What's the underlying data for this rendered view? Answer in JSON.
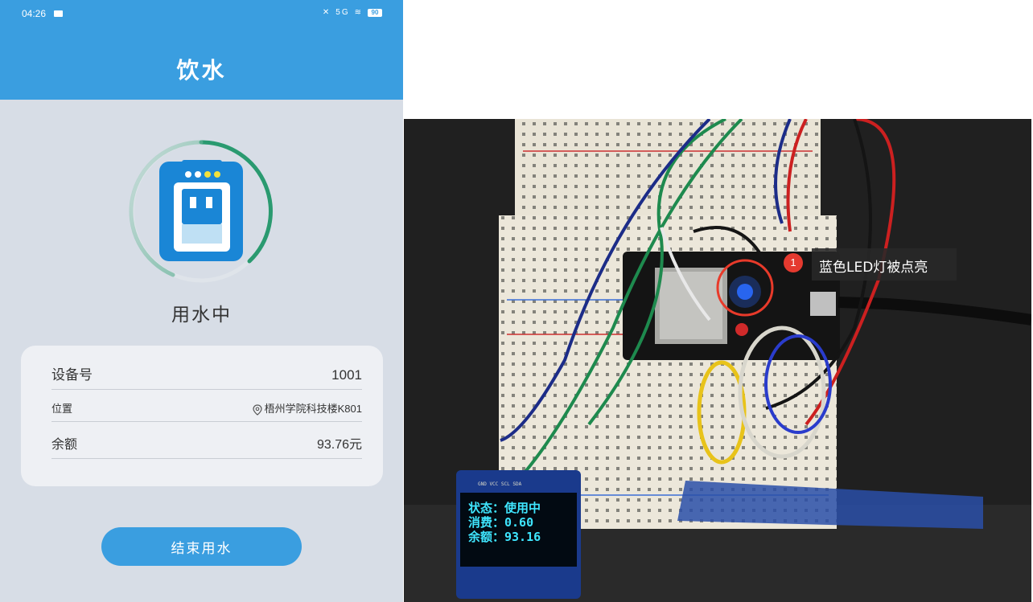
{
  "status_bar": {
    "time": "04:26",
    "network": "5G",
    "battery": "90"
  },
  "header": {
    "title": "饮水"
  },
  "usage": {
    "status_text": "用水中",
    "icon": "water-dispenser-icon"
  },
  "info": {
    "device_label": "设备号",
    "device_value": "1001",
    "location_label": "位置",
    "location_value": "梧州学院科技楼K801",
    "balance_label": "余额",
    "balance_value": "93.76元"
  },
  "actions": {
    "end_label": "结束用水"
  },
  "photo": {
    "annotation_number": "1",
    "annotation_text": "蓝色LED灯被点亮",
    "oled_lines": [
      "状态：使用中",
      "消费：0.60",
      "余额：93.16"
    ],
    "oled_header": "GND VCC SCL SDA"
  },
  "colors": {
    "accent": "#3a9ee0",
    "ring_green": "#2a9a70",
    "annotation_red": "#e53a2f",
    "oled_text": "#3fe6ff"
  }
}
